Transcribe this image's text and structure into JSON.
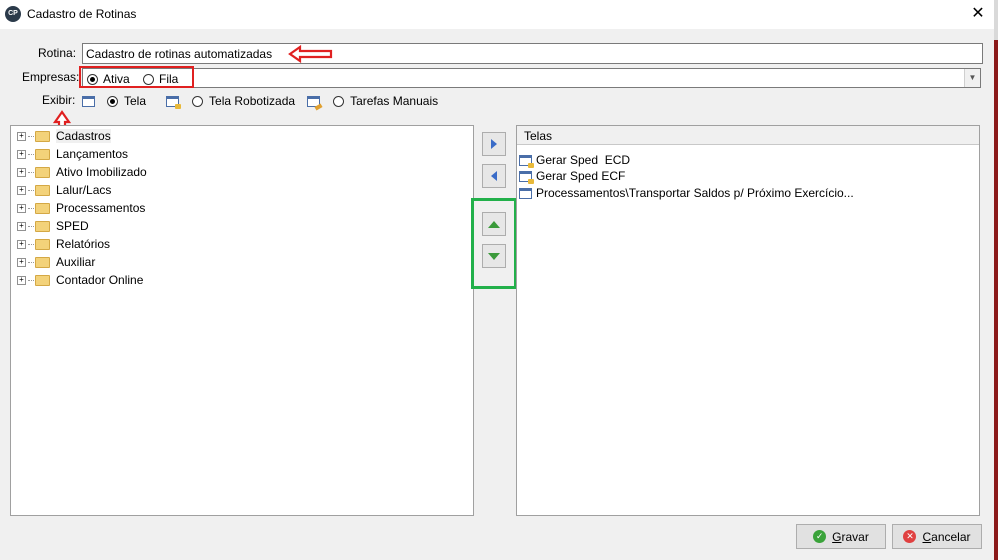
{
  "window": {
    "title": "Cadastro de Rotinas",
    "app_icon_text": "CP",
    "close_glyph": "✕"
  },
  "form": {
    "rotina_label": "Rotina:",
    "rotina_value": "Cadastro de rotinas automatizadas",
    "empresas_label": "Empresas:",
    "empresas_options": [
      {
        "label": "Ativa",
        "selected": true
      },
      {
        "label": "Fila",
        "selected": false
      }
    ],
    "empresas_dropdown_value": "",
    "exibir_label": "Exibir:",
    "exibir_options": [
      {
        "label": "Tela",
        "selected": true,
        "icon": "window-icon"
      },
      {
        "label": "Tela Robotizada",
        "selected": false,
        "icon": "robot-window-icon"
      },
      {
        "label": "Tarefas Manuais",
        "selected": false,
        "icon": "manual-task-icon"
      }
    ]
  },
  "tree": {
    "items": [
      {
        "label": "Cadastros"
      },
      {
        "label": "Lançamentos"
      },
      {
        "label": "Ativo Imobilizado"
      },
      {
        "label": "Lalur/Lacs"
      },
      {
        "label": "Processamentos"
      },
      {
        "label": "SPED"
      },
      {
        "label": "Relatórios"
      },
      {
        "label": "Auxiliar"
      },
      {
        "label": "Contador Online"
      }
    ]
  },
  "list": {
    "header": "Telas",
    "items": [
      {
        "label": "Gerar Sped  ECD",
        "icon": "robot-window-icon"
      },
      {
        "label": "Gerar Sped ECF",
        "icon": "robot-window-icon"
      },
      {
        "label": "Processamentos\\Transportar Saldos p/ Próximo Exercício...",
        "icon": "window-icon"
      }
    ]
  },
  "buttons": {
    "save": "Gravar",
    "save_mnemonic": "G",
    "save_rest": "ravar",
    "cancel": "Cancelar",
    "cancel_mnemonic": "C",
    "cancel_rest": "ancelar"
  },
  "colors": {
    "annotation_red": "#e02020",
    "annotation_green": "#22b04a"
  }
}
